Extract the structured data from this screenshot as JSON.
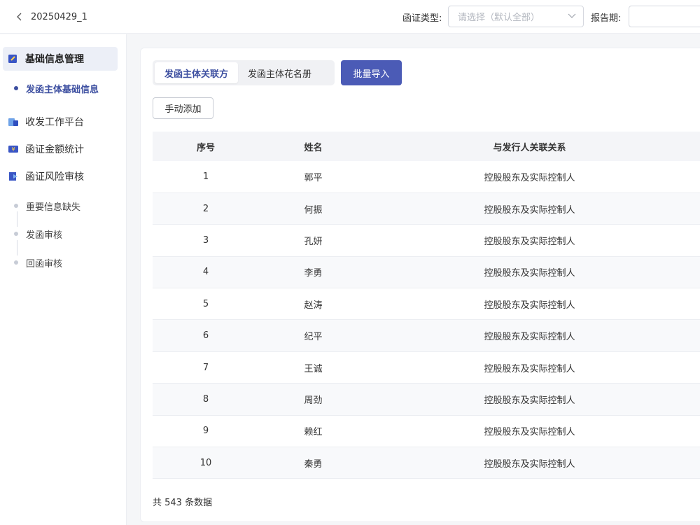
{
  "header": {
    "back_label": "20250429_1",
    "filter_type_label": "函证类型:",
    "filter_type_placeholder": "请选择（默认全部）",
    "report_period_label": "报告期:"
  },
  "sidebar": {
    "groups": [
      {
        "label": "基础信息管理",
        "icon": "doc-edit-icon",
        "active": true
      },
      {
        "label": "收发工作平台",
        "icon": "platform-icon",
        "active": false
      },
      {
        "label": "函证金额统计",
        "icon": "money-stat-icon",
        "active": false
      },
      {
        "label": "函证风险审核",
        "icon": "risk-review-icon",
        "active": false
      }
    ],
    "sub_basic": [
      {
        "label": "发函主体基础信息",
        "active": true
      }
    ],
    "sub_risk": [
      {
        "label": "重要信息缺失"
      },
      {
        "label": "发函审核"
      },
      {
        "label": "回函审核"
      }
    ]
  },
  "main": {
    "tabs": [
      {
        "label": "发函主体关联方",
        "active": true
      },
      {
        "label": "发函主体花名册",
        "active": false
      }
    ],
    "import_button": "批量导入",
    "add_button": "手动添加",
    "table": {
      "headers": [
        "序号",
        "姓名",
        "与发行人关联关系"
      ],
      "rows": [
        [
          "1",
          "郭平",
          "控股股东及实际控制人"
        ],
        [
          "2",
          "何振",
          "控股股东及实际控制人"
        ],
        [
          "3",
          "孔妍",
          "控股股东及实际控制人"
        ],
        [
          "4",
          "李勇",
          "控股股东及实际控制人"
        ],
        [
          "5",
          "赵涛",
          "控股股东及实际控制人"
        ],
        [
          "6",
          "纪平",
          "控股股东及实际控制人"
        ],
        [
          "7",
          "王诚",
          "控股股东及实际控制人"
        ],
        [
          "8",
          "周劲",
          "控股股东及实际控制人"
        ],
        [
          "9",
          "赖红",
          "控股股东及实际控制人"
        ],
        [
          "10",
          "秦勇",
          "控股股东及实际控制人"
        ]
      ]
    },
    "total_text": "共 543 条数据"
  },
  "colors": {
    "primary": "#4b5bb6",
    "active_text": "#3c4ea0",
    "active_bg": "#eceff7"
  }
}
